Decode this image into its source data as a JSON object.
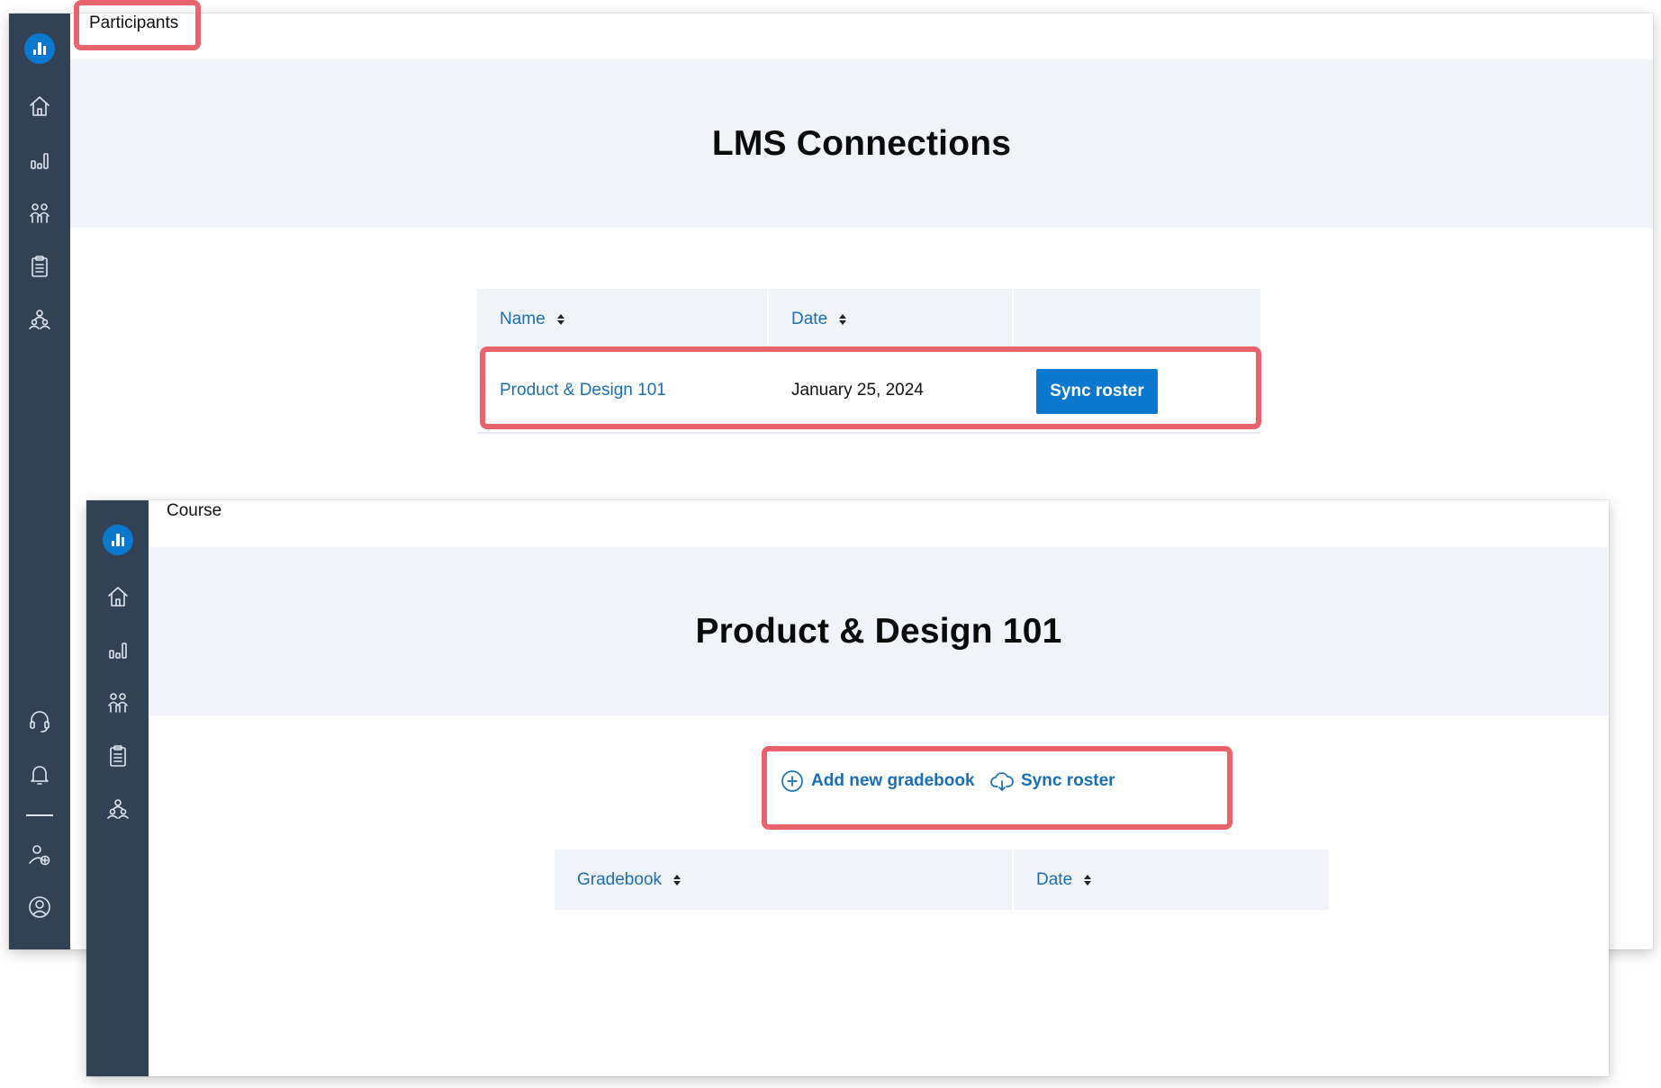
{
  "participants_window": {
    "breadcrumb": "Participants",
    "page_title": "LMS Connections",
    "table": {
      "columns": [
        {
          "label": "Name",
          "sortable": true
        },
        {
          "label": "Date",
          "sortable": true
        },
        {
          "label": "",
          "sortable": false
        }
      ],
      "rows": [
        {
          "name": "Product & Design 101",
          "date": "January 25, 2024",
          "action": "Sync roster"
        }
      ]
    },
    "sidebar": {
      "top_icons": [
        "logo-icon",
        "home-icon",
        "bar-chart-icon",
        "people-icon",
        "clipboard-icon",
        "group-icon"
      ],
      "bottom_icons": [
        "headset-icon",
        "bell-icon",
        "add-user-icon",
        "account-icon"
      ]
    }
  },
  "course_window": {
    "breadcrumb": "Course",
    "page_title": "Product & Design 101",
    "actions": {
      "add_gradebook": "Add new gradebook",
      "sync_roster": "Sync roster"
    },
    "table": {
      "columns": [
        {
          "label": "Gradebook",
          "sortable": true
        },
        {
          "label": "Date",
          "sortable": true
        }
      ]
    },
    "sidebar": {
      "top_icons": [
        "logo-icon",
        "home-icon",
        "bar-chart-icon",
        "people-icon",
        "clipboard-icon",
        "group-icon"
      ]
    }
  },
  "colors": {
    "sidebar": "#334155",
    "accent": "#0b78d0",
    "link": "#1a6fb4",
    "hero_bg": "#f0f4f8",
    "callout": "#e8636b"
  }
}
